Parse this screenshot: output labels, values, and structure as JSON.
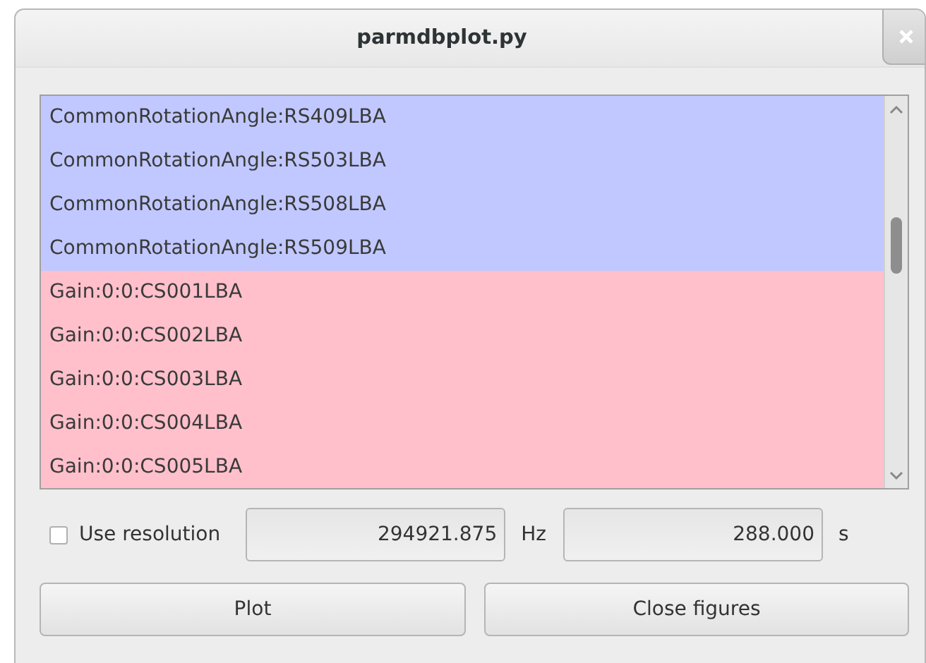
{
  "window": {
    "title": "parmdbplot.py"
  },
  "list": {
    "items": [
      {
        "label": "CommonRotationAngle:RS409LBA",
        "color": "#c0c8ff"
      },
      {
        "label": "CommonRotationAngle:RS503LBA",
        "color": "#c0c8ff"
      },
      {
        "label": "CommonRotationAngle:RS508LBA",
        "color": "#c0c8ff"
      },
      {
        "label": "CommonRotationAngle:RS509LBA",
        "color": "#c0c8ff"
      },
      {
        "label": "Gain:0:0:CS001LBA",
        "color": "#ffc0cb"
      },
      {
        "label": "Gain:0:0:CS002LBA",
        "color": "#ffc0cb"
      },
      {
        "label": "Gain:0:0:CS003LBA",
        "color": "#ffc0cb"
      },
      {
        "label": "Gain:0:0:CS004LBA",
        "color": "#ffc0cb"
      },
      {
        "label": "Gain:0:0:CS005LBA",
        "color": "#ffc0cb"
      }
    ]
  },
  "resolution": {
    "label": "Use resolution",
    "checked": false,
    "frequency": {
      "value": "294921.875",
      "unit": "Hz"
    },
    "time": {
      "value": "288.000",
      "unit": "s"
    }
  },
  "buttons": [
    "Plot",
    "Close figures"
  ]
}
